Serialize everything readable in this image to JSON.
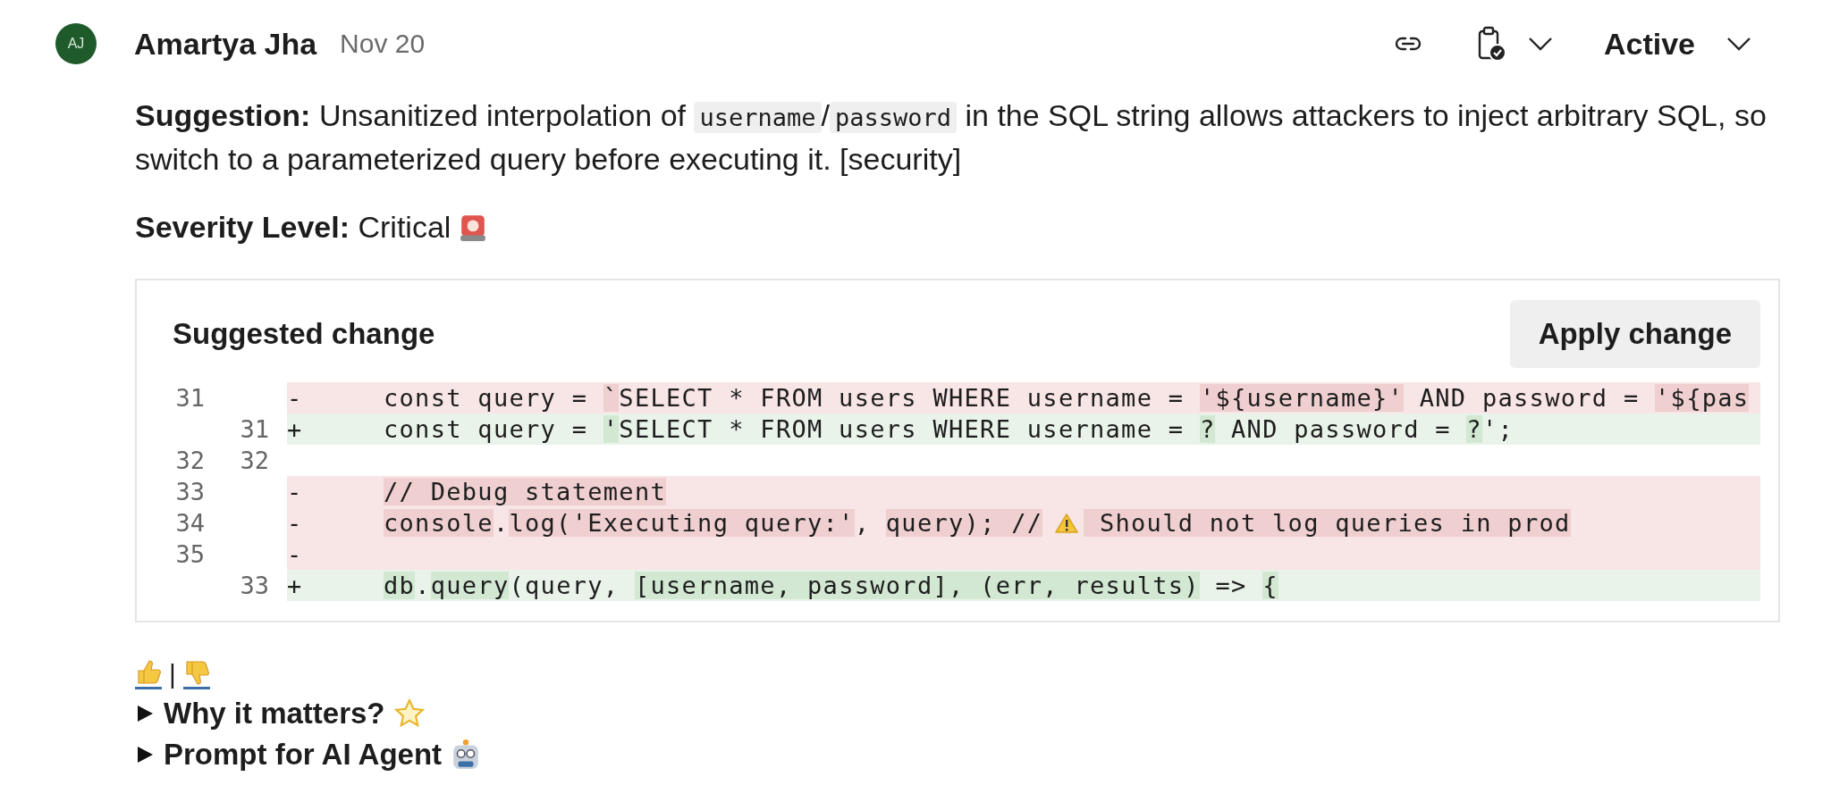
{
  "author": {
    "initials": "AJ",
    "name": "Amartya Jha",
    "date": "Nov 20"
  },
  "status": {
    "label": "Active"
  },
  "suggestion": [
    {
      "kind": "bold",
      "text": "Suggestion:"
    },
    {
      "kind": "text",
      "text": " Unsanitized interpolation of "
    },
    {
      "kind": "code",
      "text": "username"
    },
    {
      "kind": "text",
      "text": "/"
    },
    {
      "kind": "code",
      "text": "password"
    },
    {
      "kind": "text",
      "text": " in the SQL string allows attackers to inject arbitrary SQL, so switch to a parameterized query before executing it. [security]"
    }
  ],
  "severity": {
    "label": "Severity Level:",
    "value": "Critical"
  },
  "suggested_change": {
    "title": "Suggested change",
    "button": "Apply change",
    "lines": [
      {
        "kind": "removed",
        "old": "31",
        "sign": "-",
        "segments": [
          {
            "text": "const query = ",
            "changed": false
          },
          {
            "text": "`",
            "changed": true
          },
          {
            "text": "SELECT * FROM users WHERE username = ",
            "changed": false
          },
          {
            "text": "'${username}'",
            "changed": true
          },
          {
            "text": " AND password = ",
            "changed": false
          },
          {
            "text": "'${pas",
            "changed": true
          }
        ]
      },
      {
        "kind": "added",
        "new": "31",
        "sign": "+",
        "segments": [
          {
            "text": "const query = ",
            "changed": false
          },
          {
            "text": "'",
            "changed": true
          },
          {
            "text": "SELECT * FROM users WHERE username = ",
            "changed": false
          },
          {
            "text": "?",
            "changed": true
          },
          {
            "text": " AND password = ",
            "changed": false
          },
          {
            "text": "?",
            "changed": true
          },
          {
            "text": "';",
            "changed": false
          }
        ]
      },
      {
        "kind": "context",
        "old": "32",
        "new": "32"
      },
      {
        "kind": "removed",
        "old": "33",
        "sign": "-",
        "segments": [
          {
            "text": "// Debug statement",
            "changed": true
          }
        ]
      },
      {
        "kind": "removed",
        "old": "34",
        "sign": "-",
        "segments": [
          {
            "text": "console",
            "changed": true
          },
          {
            "text": ".",
            "changed": false
          },
          {
            "text": "log('Executing query:'",
            "changed": true
          },
          {
            "text": ", ",
            "changed": false
          },
          {
            "text": "query); //",
            "changed": true
          },
          {
            "kind": "warning"
          },
          {
            "text": " Should not log queries in prod",
            "changed": true
          }
        ]
      },
      {
        "kind": "removed",
        "old": "35",
        "sign": "-"
      },
      {
        "kind": "added",
        "new": "33",
        "sign": "+",
        "segments": [
          {
            "text": "db",
            "changed": true
          },
          {
            "text": ".",
            "changed": false
          },
          {
            "text": "query",
            "changed": true
          },
          {
            "text": "(query, ",
            "changed": false
          },
          {
            "text": "[username, password], (err, results)",
            "changed": true
          },
          {
            "text": " => ",
            "changed": false
          },
          {
            "text": "{",
            "changed": true
          }
        ]
      }
    ]
  },
  "feedback": {
    "separator": "|"
  },
  "sections": [
    {
      "label": "Why it matters?",
      "expanded": false
    },
    {
      "label": "Prompt for AI Agent",
      "expanded": false
    }
  ]
}
